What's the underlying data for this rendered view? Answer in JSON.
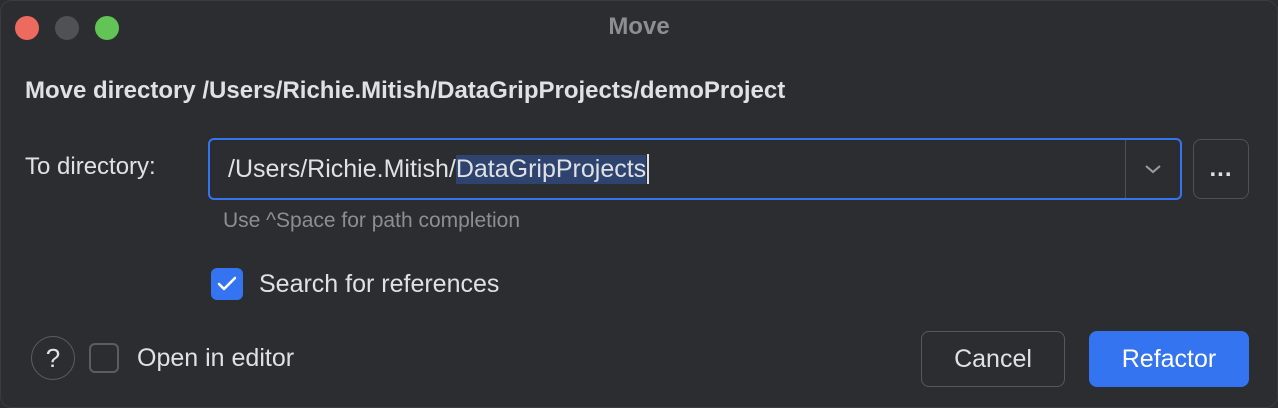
{
  "window": {
    "title": "Move"
  },
  "heading": "Move directory /Users/Richie.Mitish/DataGripProjects/demoProject",
  "to_directory": {
    "label": "To directory:",
    "value_unselected": "/Users/Richie.Mitish/",
    "value_selected": "DataGripProjects",
    "hint": "Use ^Space for path completion",
    "browse_label": "...",
    "dropdown_icon": "chevron-down-icon"
  },
  "search_references": {
    "label": "Search for references",
    "checked": true
  },
  "open_in_editor": {
    "label": "Open in editor",
    "checked": false
  },
  "help": {
    "label": "?"
  },
  "buttons": {
    "cancel": "Cancel",
    "refactor": "Refactor"
  },
  "colors": {
    "accent": "#3574f0",
    "background": "#2b2d30",
    "selection": "#2e436e"
  }
}
